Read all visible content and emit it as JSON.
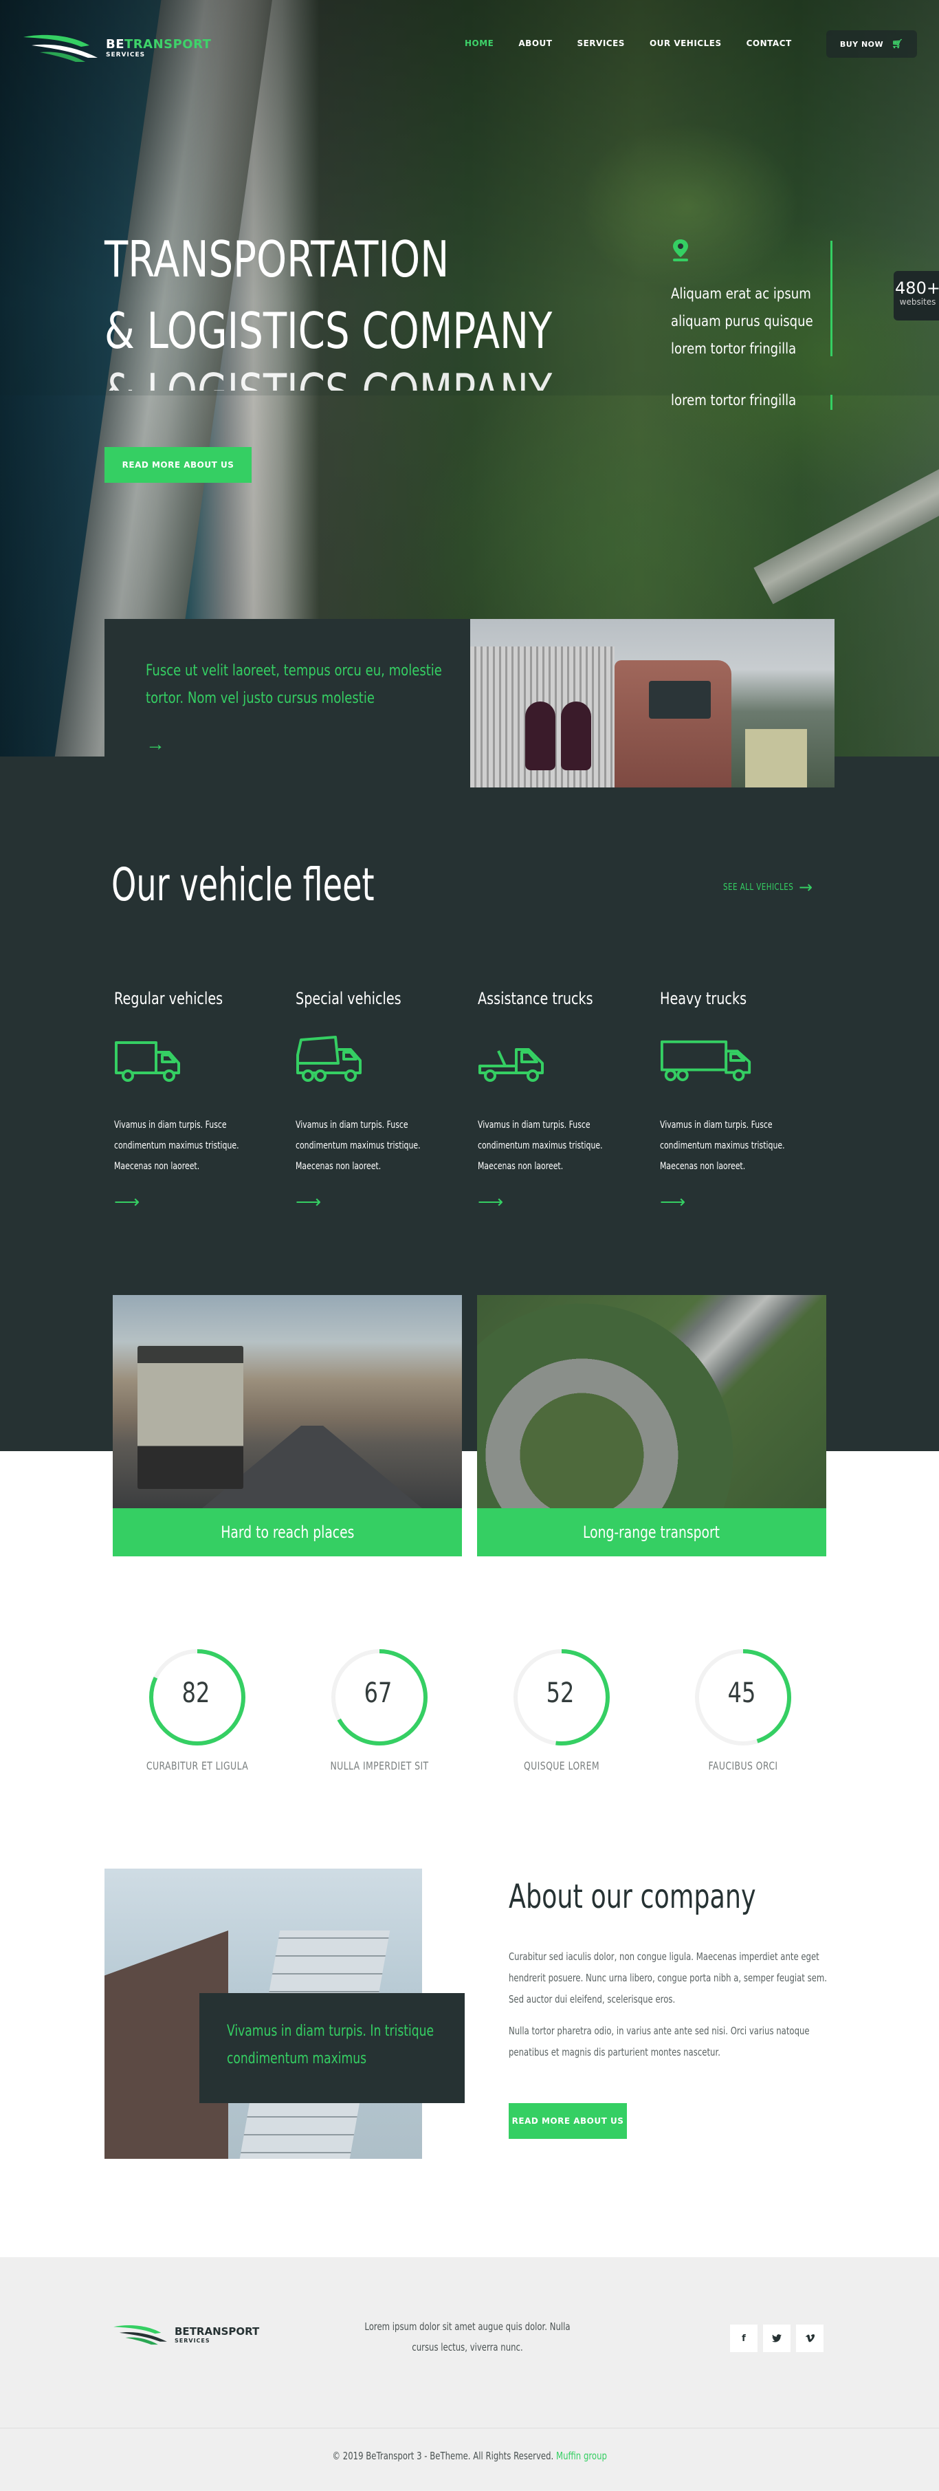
{
  "brand": {
    "name_prefix": "BE",
    "name_suffix": "TRANSPORT",
    "tagline": "SERVICES",
    "accent_color": "#35cf63",
    "dark_color": "#263233"
  },
  "nav": {
    "items": [
      {
        "label": "HOME",
        "active": true
      },
      {
        "label": "ABOUT",
        "active": false
      },
      {
        "label": "SERVICES",
        "active": false
      },
      {
        "label": "OUR VEHICLES",
        "active": false
      },
      {
        "label": "CONTACT",
        "active": false
      }
    ],
    "buy_label": "BUY NOW",
    "buy_icon": "cart-icon"
  },
  "hero": {
    "title_line1": "TRANSPORTATION",
    "title_line2": "& LOGISTICS COMPANY",
    "title_ghost": "& LOGISTICS COMPANY",
    "button_label": "READ MORE ABOUT US",
    "side_icon": "location-pin-icon",
    "side_lines": [
      "Aliquam erat ac ipsum",
      "aliquam purus quisque",
      "lorem tortor fringilla"
    ],
    "side_ghost": "lorem tortor fringilla"
  },
  "badge": {
    "number": "480+",
    "label": "websites"
  },
  "feature": {
    "text": "Fusce ut velit laoreet, tempus orcu eu, molestie tortor. Nom vel justo cursus molestie",
    "arrow": "→"
  },
  "fleet": {
    "title": "Our vehicle fleet",
    "see_all_label": "SEE ALL VEHICLES",
    "see_all_arrow": "→",
    "vehicles": [
      {
        "title": "Regular vehicles",
        "icon": "box-truck-icon",
        "description": "Vivamus in diam turpis. Fusce condimentum maximus tristique. Maecenas non laoreet.",
        "arrow": "⟶"
      },
      {
        "title": "Special vehicles",
        "icon": "dump-truck-icon",
        "description": "Vivamus in diam turpis. Fusce condimentum maximus tristique. Maecenas non laoreet.",
        "arrow": "⟶"
      },
      {
        "title": "Assistance trucks",
        "icon": "tow-truck-icon",
        "description": "Vivamus in diam turpis. Fusce condimentum maximus tristique. Maecenas non laoreet.",
        "arrow": "⟶"
      },
      {
        "title": "Heavy trucks",
        "icon": "semi-truck-icon",
        "description": "Vivamus in diam turpis. Fusce condimentum maximus tristique. Maecenas non laoreet.",
        "arrow": "⟶"
      }
    ],
    "cards": [
      {
        "label": "Hard to reach places"
      },
      {
        "label": "Long-range transport"
      }
    ]
  },
  "stats": [
    {
      "value": "82",
      "percent": 82,
      "label": "CURABITUR ET LIGULA"
    },
    {
      "value": "67",
      "percent": 67,
      "label": "NULLA IMPERDIET SIT"
    },
    {
      "value": "52",
      "percent": 52,
      "label": "QUISQUE LOREM"
    },
    {
      "value": "45",
      "percent": 45,
      "label": "FAUCIBUS ORCI"
    }
  ],
  "about": {
    "title": "About our company",
    "box_text": "Vivamus in diam turpis. In tristique condimentum maximus",
    "paragraph1": "Curabitur sed iaculis dolor, non congue ligula. Maecenas imperdiet ante eget hendrerit posuere. Nunc urna libero, congue porta nibh a, semper feugiat sem. Sed auctor dui eleifend, scelerisque eros.",
    "paragraph2": "Nulla tortor pharetra odio, in varius ante ante sed nisi. Orci varius natoque penatibus et magnis dis parturient montes nascetur.",
    "button_label": "READ MORE ABOUT US"
  },
  "footer": {
    "text": "Lorem ipsum dolor sit amet augue quis dolor. Nulla cursus lectus, viverra nunc.",
    "social": [
      {
        "icon": "facebook-icon",
        "glyph": "f"
      },
      {
        "icon": "twitter-icon",
        "glyph": "t"
      },
      {
        "icon": "vimeo-icon",
        "glyph": "v"
      }
    ],
    "copyright": "© 2019 BeTransport 3 - BeTheme. All Rights Reserved.",
    "credit": "Muffin group"
  }
}
